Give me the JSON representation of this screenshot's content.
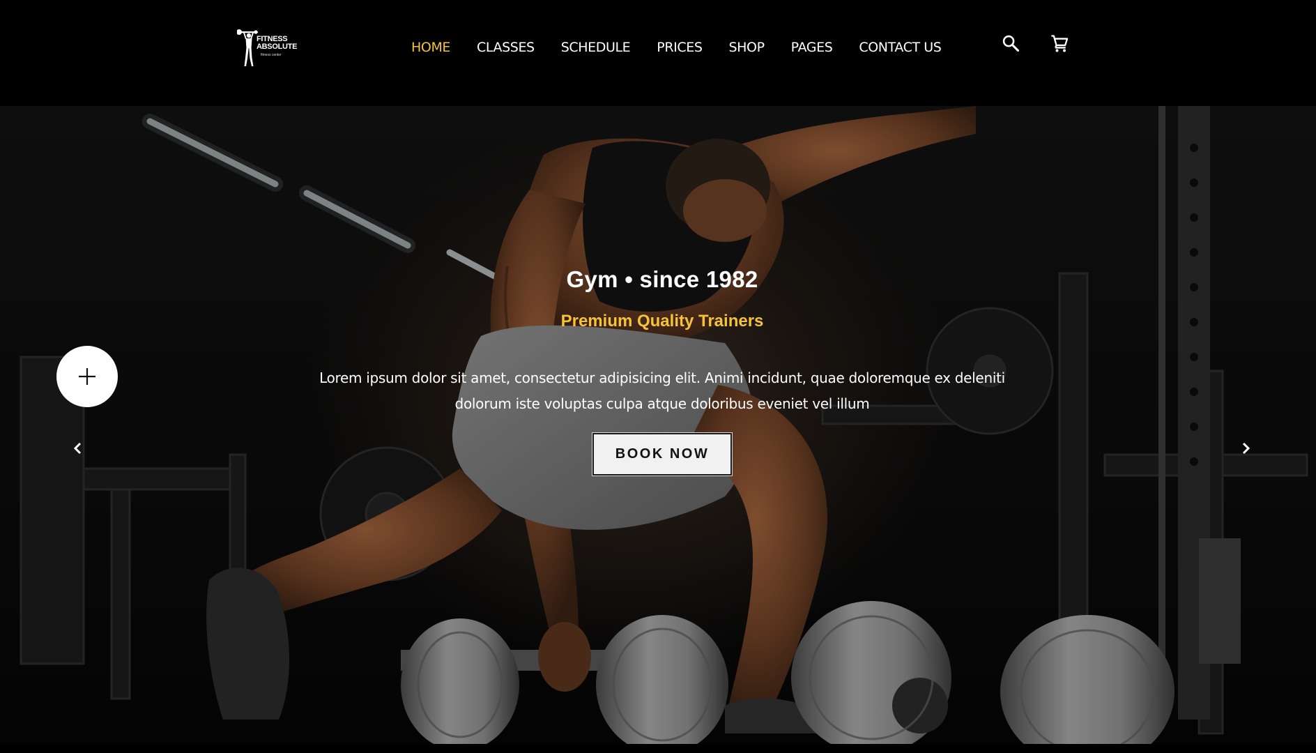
{
  "header": {
    "logo": {
      "line1": "FITNESS",
      "line2": "ABSOLUTE",
      "tagline": "fitness center"
    },
    "nav": [
      {
        "label": "HOME",
        "active": true
      },
      {
        "label": "CLASSES",
        "active": false
      },
      {
        "label": "SCHEDULE",
        "active": false
      },
      {
        "label": "PRICES",
        "active": false
      },
      {
        "label": "SHOP",
        "active": false
      },
      {
        "label": "PAGES",
        "active": false
      },
      {
        "label": "CONTACT US",
        "active": false
      }
    ],
    "icons": [
      "search-icon",
      "cart-icon"
    ]
  },
  "hero": {
    "title": "Gym • since 1982",
    "subtitle": "Premium Quality Trainers",
    "description": "Lorem ipsum dolor sit amet, consectetur adipisicing elit. Animi incidunt, quae doloremque ex deleniti dolorum iste voluptas culpa atque doloribus eveniet vel illum",
    "cta_label": "BOOK NOW",
    "plus_icon": "plus-icon",
    "prev_icon": "chevron-left-icon",
    "next_icon": "chevron-right-icon"
  },
  "colors": {
    "background": "#000000",
    "accent": "#f5c33b",
    "text": "#ffffff",
    "button_bg": "#f1f1f1"
  }
}
